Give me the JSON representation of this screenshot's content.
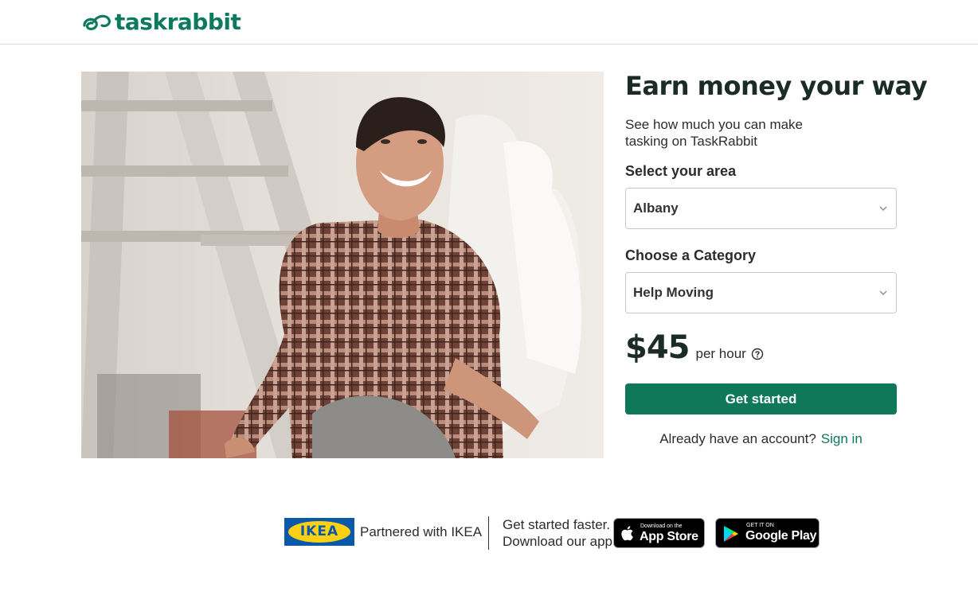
{
  "header": {
    "logo_text": "taskrabbit",
    "brand_color": "#0d7a5f"
  },
  "hero": {
    "image_subject": "smiling woman in plaid shirt sitting beside ladder"
  },
  "panel": {
    "headline": "Earn money your way",
    "subtext": "See how much you can make tasking on TaskRabbit",
    "area_label": "Select your area",
    "area_value": "Albany",
    "category_label": "Choose a Category",
    "category_value": "Help Moving",
    "price": "$45",
    "price_unit": "per hour",
    "cta_label": "Get started",
    "account_prompt": "Already have an account?",
    "signin_label": "Sign in",
    "accent_color": "#0f7859"
  },
  "footer": {
    "ikea_logo_text": "IKEA",
    "partner_text": "Partnered with IKEA",
    "app_line1": "Get started faster.",
    "app_line2": "Download our app",
    "app_store_small": "Download on the",
    "app_store_big": "App Store",
    "google_small": "GET IT ON",
    "google_big": "Google Play"
  }
}
